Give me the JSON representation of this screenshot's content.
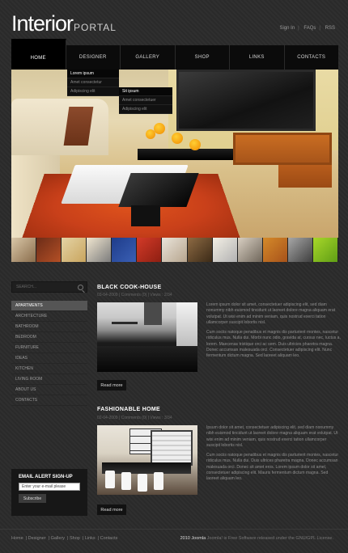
{
  "header": {
    "logo_main": "Interior",
    "logo_sub": "PORTAL",
    "top_links": [
      "Sign In",
      "FAQs",
      "RSS"
    ]
  },
  "nav": {
    "items": [
      "HOME",
      "DESIGNER",
      "GALLERY",
      "SHOP",
      "LINKS",
      "CONTACTS"
    ],
    "active": "HOME"
  },
  "dropdowns": {
    "designer_menu": [
      "Lorem ipsum",
      "Amet consectetur",
      "Adipiscing elit"
    ],
    "submenu": [
      "Sit ipsum",
      "Amet consectetuer",
      "Adipiscing elit"
    ]
  },
  "sidebar": {
    "search_placeholder": "SEARCH...",
    "categories": [
      "APARTMENTS",
      "ARCHITECTURE",
      "BATHROOM",
      "BEDROOM",
      "FURNITURE",
      "IDEAS",
      "KITCHEN",
      "LIVING ROOM",
      "ABOUT US",
      "CONTACTS"
    ],
    "active_category": "APARTMENTS",
    "alert": {
      "title": "EMAIL ALERT SIGN-UP",
      "input_placeholder": "Enter your e-mail please",
      "button_label": "Subscribe"
    }
  },
  "posts": [
    {
      "title": "BLACK COOK-HOUSE",
      "meta": "03-04-2009  |  Comments (0)  |  Views : 2/34",
      "paragraph1": "Lorem ipsum dolor sit amet, consectetuer adipiscing elit, sed diam nonummy nibh euismod tincidunt ut laoreet dolore magna aliquam erat volutpat. Ut wisi enim ad minim veniam, quis nostrud exerci tation ullamcorper suscipit lobortis nisl.",
      "paragraph2": "Cum sociis natoque penatibus et magnis dis parturient montes, nascetur ridiculus mus. Nulla dui. Morbi nunc odio, gravida at, cursus nec, luctus a, lorem. Maecenas tristique orci ac sem. Duis ultricies pharetra magna. Donec accumsan malesuada orci. Consectetuer adipiscing elit. Nunc fermentum dictum magna. Sed laoreet aliquam leo.",
      "read_more": "Read more"
    },
    {
      "title": "FASHIONABLE HOME",
      "meta": "02-04-2009  |  Comments (0)  |  Views : 3/34",
      "paragraph1": "Ipsum dolor sit amet, consectetuer adipiscing elit, sed diam nonummy nibh euismod tincidunt ut laoreet dolore magna aliquam erat volutpat. Ut wisi enim ad minim veniam, quis nostrud exerci tation ullamcorper suscipit lobortis nisl.",
      "paragraph2": "Cum sociis natoque penatibus et magnis dis parturient montes, nascetur ridiculus mus. Nulla dui. Duis ultrices pharetra magna. Donec accumsan malesuada orci. Donec sit amet eros. Lorem ipsum dolor sit amet, consectetuer adipiscing elit. Mauris fermentum dictum magna. Sed laoreet aliquam leo.",
      "read_more": "Read more"
    }
  ],
  "footer": {
    "links": [
      "Home",
      "Designer",
      "Gallery",
      "Shop",
      "Links",
      "Contacts"
    ],
    "copyright_year": "2010",
    "copyright_brand": "Joomla",
    "copyright_text": "Joomla! is Free Software released under the GNU/GPL License."
  },
  "colors": {
    "background": "#2b2b2b",
    "nav_bg": "#0b0b0b",
    "accent_rug": "#e0541c",
    "accent_wood": "#c96d22"
  }
}
